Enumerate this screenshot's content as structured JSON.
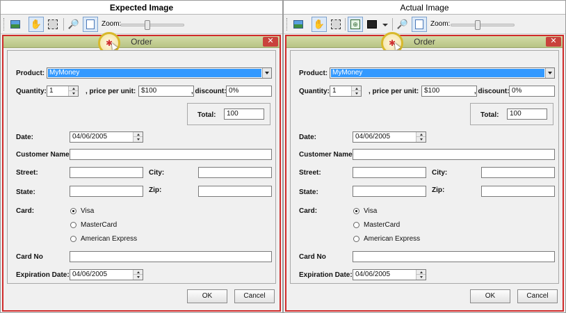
{
  "panels": {
    "left": {
      "header": "Expected Image",
      "toolbar_buttons": [
        "image-icon",
        "hand-icon",
        "select-icon",
        "magnifier-icon",
        "page-icon"
      ]
    },
    "right": {
      "header": "Actual Image",
      "toolbar_buttons": [
        "image-icon",
        "hand-icon",
        "select-icon",
        "fit-icon",
        "dark-icon",
        "magnifier-icon",
        "page-icon"
      ]
    }
  },
  "toolbar": {
    "zoom_label": "Zoom:",
    "zoom_level": 0.42
  },
  "dialog": {
    "title": "Order",
    "close": "✕",
    "product_label": "Product:",
    "product_value": "MyMoney",
    "quantity_label": "Quantity:",
    "quantity_value": "1",
    "price_label": ", price per unit:",
    "price_value": "$100",
    "discount_label": ", discount:",
    "discount_value": "0%",
    "total_label": "Total:",
    "total_value": "100",
    "date_label": "Date:",
    "date_value": "04/06/2005",
    "customer_label": "Customer Name:",
    "customer_value": "",
    "street_label": "Street:",
    "city_label": "City:",
    "state_label": "State:",
    "zip_label": "Zip:",
    "card_label": "Card:",
    "card_options": [
      "Visa",
      "MasterCard",
      "American Express"
    ],
    "card_selected": "Visa",
    "cardno_label": "Card No",
    "exp_label": "Expiration Date:",
    "exp_value": "04/06/2005",
    "ok_label": "OK",
    "cancel_label": "Cancel"
  },
  "colors": {
    "dialog_border": "#cf2b2b",
    "title_bar": "#c5d095",
    "selection": "#3399ff",
    "cursor_ring": "#d8b92b"
  }
}
